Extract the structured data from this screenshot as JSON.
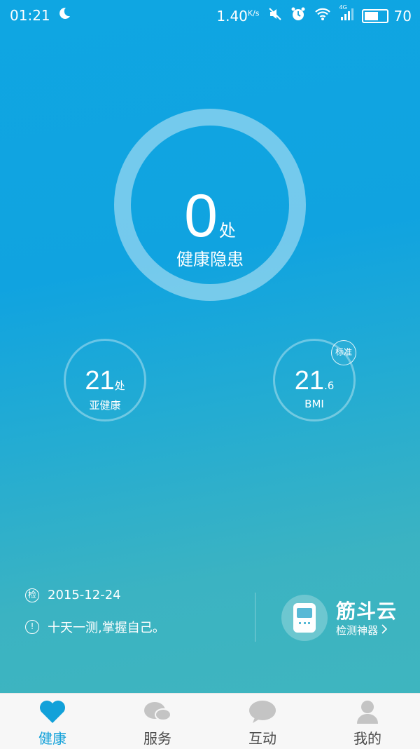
{
  "status_bar": {
    "time": "01:21",
    "speed": "1.40",
    "speed_unit": "K/s",
    "network": "4G",
    "battery": "70",
    "battery_level": 0.7
  },
  "health": {
    "hazard_count": "0",
    "hazard_unit": "处",
    "hazard_label": "健康隐患"
  },
  "sub_health": {
    "value": "21",
    "unit": "处",
    "label": "亚健康"
  },
  "bmi": {
    "value_int": "21",
    "value_dec": ".6",
    "label": "BMI",
    "badge": "标准"
  },
  "info": {
    "date_icon_char": "检",
    "date": "2015-12-24",
    "tip": "十天一测,掌握自己。"
  },
  "device": {
    "brand": "筋斗云",
    "subtitle": "检测神器"
  },
  "tabs": [
    {
      "label": "健康",
      "icon": "heart-icon"
    },
    {
      "label": "服务",
      "icon": "service-icon"
    },
    {
      "label": "互动",
      "icon": "chat-icon"
    },
    {
      "label": "我的",
      "icon": "user-icon"
    }
  ],
  "colors": {
    "accent": "#12a1d9",
    "tab_inactive_icon": "#c4c4c4"
  }
}
